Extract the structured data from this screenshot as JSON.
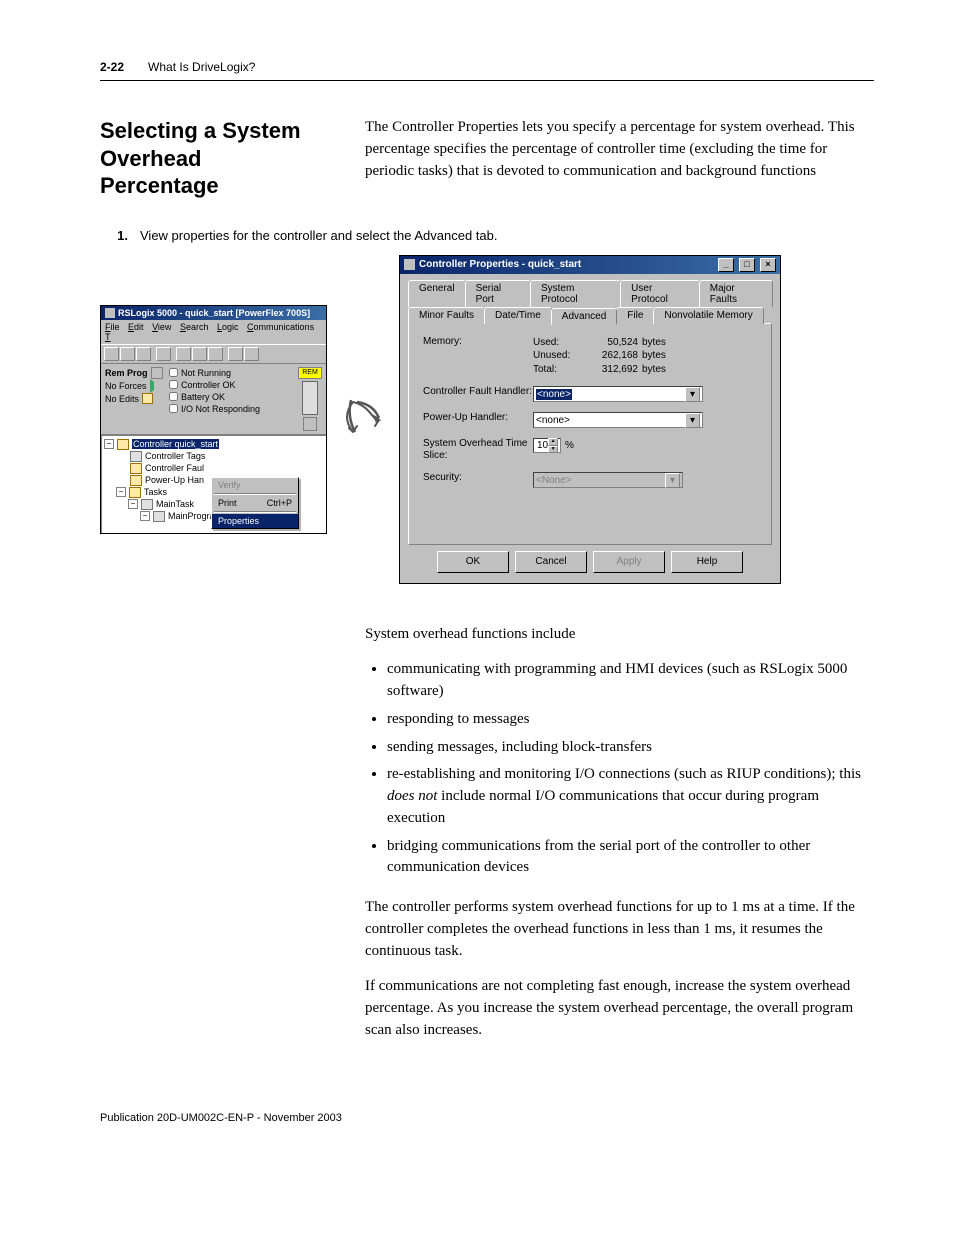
{
  "header": {
    "pagenum": "2-22",
    "chapter": "What Is DriveLogix?"
  },
  "section": {
    "title": "Selecting a System Overhead Percentage",
    "intro": "The Controller Properties lets you specify a percentage for system overhead. This percentage specifies the percentage of controller time (excluding the time for periodic tasks) that is devoted to communication and background functions"
  },
  "step": {
    "num": "1.",
    "text": "View properties for the controller and select the Advanced tab."
  },
  "rslogix": {
    "title": "RSLogix 5000 - quick_start [PowerFlex 700S]",
    "menus": [
      "File",
      "Edit",
      "View",
      "Search",
      "Logic",
      "Communications",
      "T"
    ],
    "status": {
      "mode": "Rem Prog",
      "forces": "No Forces",
      "edits": "No Edits",
      "rem": "REM",
      "checks": [
        "Not Running",
        "Controller OK",
        "Battery OK",
        "I/O Not Responding"
      ]
    },
    "tree": {
      "root": "Controller quick_start",
      "items": [
        "Controller Tags",
        "Controller Faul",
        "Power-Up Han"
      ],
      "tasks": "Tasks",
      "main": "MainTask",
      "prog": "MainProgram"
    },
    "ctx": {
      "verify": "Verify",
      "print": "Print",
      "print_sc": "Ctrl+P",
      "props": "Properties"
    }
  },
  "dialog": {
    "title": "Controller Properties - quick_start",
    "tabs_top": [
      "General",
      "Serial Port",
      "System Protocol",
      "User Protocol",
      "Major Faults"
    ],
    "tabs_bot": [
      "Minor Faults",
      "Date/Time",
      "Advanced",
      "File",
      "Nonvolatile Memory"
    ],
    "mem_label": "Memory:",
    "mem": [
      {
        "k": "Used:",
        "v": "50,524",
        "u": "bytes"
      },
      {
        "k": "Unused:",
        "v": "262,168",
        "u": "bytes"
      },
      {
        "k": "Total:",
        "v": "312,692",
        "u": "bytes"
      }
    ],
    "cfh_label": "Controller Fault Handler:",
    "cfh_value": "<none>",
    "puh_label": "Power-Up Handler:",
    "puh_value": "<none>",
    "sots_label": "System Overhead Time Slice:",
    "sots_value": "10",
    "sots_unit": "%",
    "sec_label": "Security:",
    "sec_value": "<None>",
    "buttons": {
      "ok": "OK",
      "cancel": "Cancel",
      "apply": "Apply",
      "help": "Help"
    }
  },
  "body": {
    "p1": "System overhead functions include",
    "bullets": [
      "communicating with programming and HMI devices (such as RSLogix 5000 software)",
      "responding to messages",
      "sending messages, including block-transfers",
      "re-establishing and monitoring I/O connections (such as RIUP conditions); this does not include normal I/O communications that occur during program execution",
      "bridging communications from the serial port of the controller to other communication devices"
    ],
    "p2": "The controller performs system overhead functions for up to 1 ms at a time. If the controller completes the overhead functions in less than 1 ms, it resumes the continuous task.",
    "p3": "If communications are not completing fast enough, increase the system overhead percentage. As you increase the system overhead percentage, the overall program scan also increases."
  },
  "footer": "Publication 20D-UM002C-EN-P - November 2003"
}
